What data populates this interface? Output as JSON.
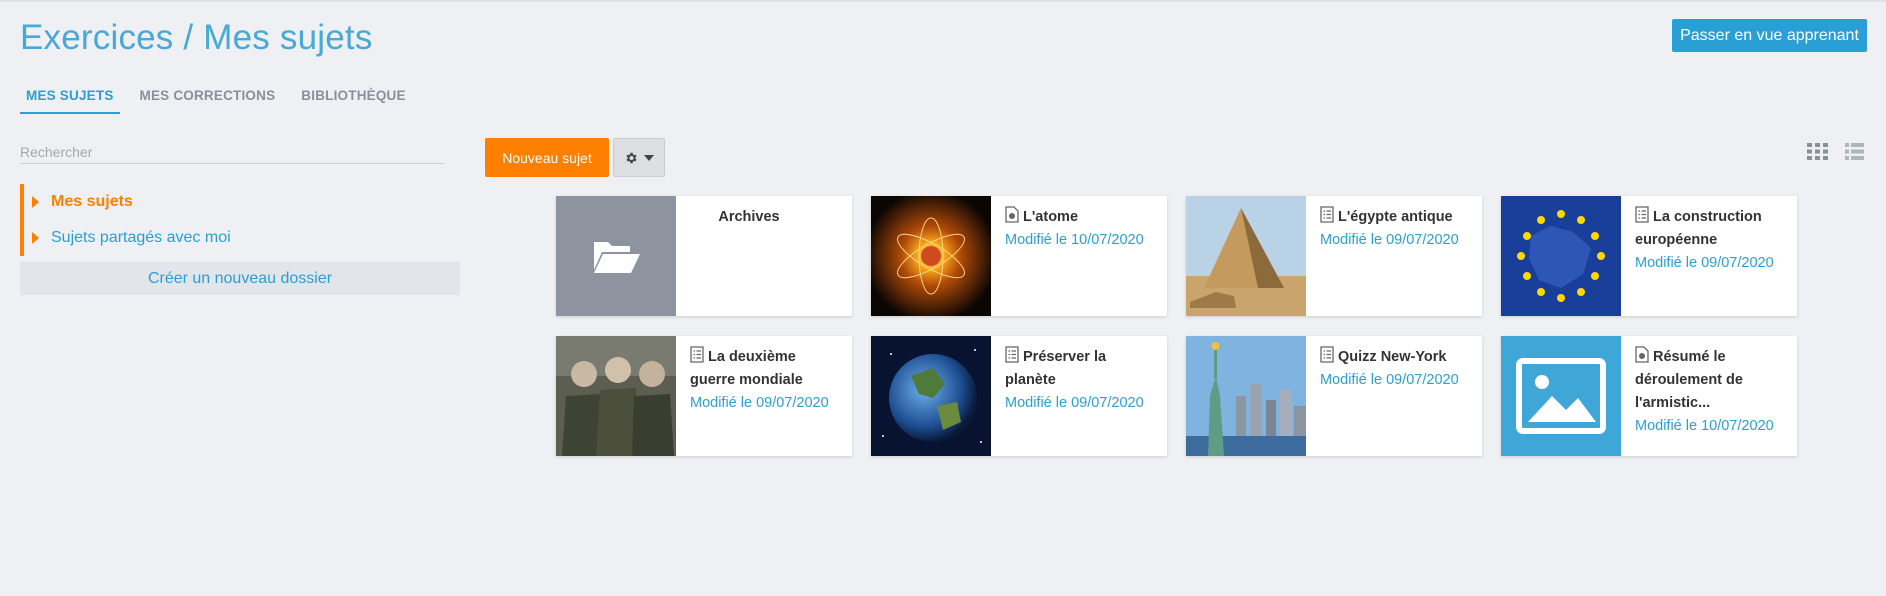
{
  "header": {
    "title": "Exercices / Mes sujets",
    "learner_button": "Passer en vue apprenant"
  },
  "tabs": [
    {
      "label": "MES SUJETS",
      "active": true
    },
    {
      "label": "MES CORRECTIONS",
      "active": false
    },
    {
      "label": "BIBLIOTHÈQUE",
      "active": false
    }
  ],
  "sidebar": {
    "search_placeholder": "Rechercher",
    "folders": [
      {
        "label": "Mes sujets",
        "active": true
      },
      {
        "label": "Sujets partagés avec moi",
        "active": false
      }
    ],
    "new_folder": "Créer un nouveau dossier"
  },
  "toolbar": {
    "new_subject": "Nouveau sujet",
    "settings_icon": "gear-icon",
    "view_icons": [
      "grid-view-icon",
      "list-view-icon"
    ]
  },
  "cards": [
    {
      "title": "Archives",
      "date": "",
      "icon": "folder-icon"
    },
    {
      "title": "L'atome",
      "date": "Modifié le 10/07/2020",
      "icon": "doc-quiz-icon"
    },
    {
      "title": "L'égypte antique",
      "date": "Modifié le 09/07/2020",
      "icon": "doc-list-icon"
    },
    {
      "title": "La construction européenne",
      "date": "Modifié le 09/07/2020",
      "icon": "doc-list-icon"
    },
    {
      "title": "La deuxième guerre mondiale",
      "date": "Modifié le 09/07/2020",
      "icon": "doc-list-icon"
    },
    {
      "title": "Préserver la planète",
      "date": "Modifié le 09/07/2020",
      "icon": "doc-list-icon"
    },
    {
      "title": "Quizz New-York",
      "date": "Modifié le 09/07/2020",
      "icon": "doc-list-icon"
    },
    {
      "title": "Résumé le déroulement de l'armistic...",
      "date": "Modifié le 10/07/2020",
      "icon": "doc-quiz-icon"
    }
  ],
  "colors": {
    "accent": "#2a9fd6",
    "orange": "#ff7f00",
    "background": "#eef0f3"
  }
}
